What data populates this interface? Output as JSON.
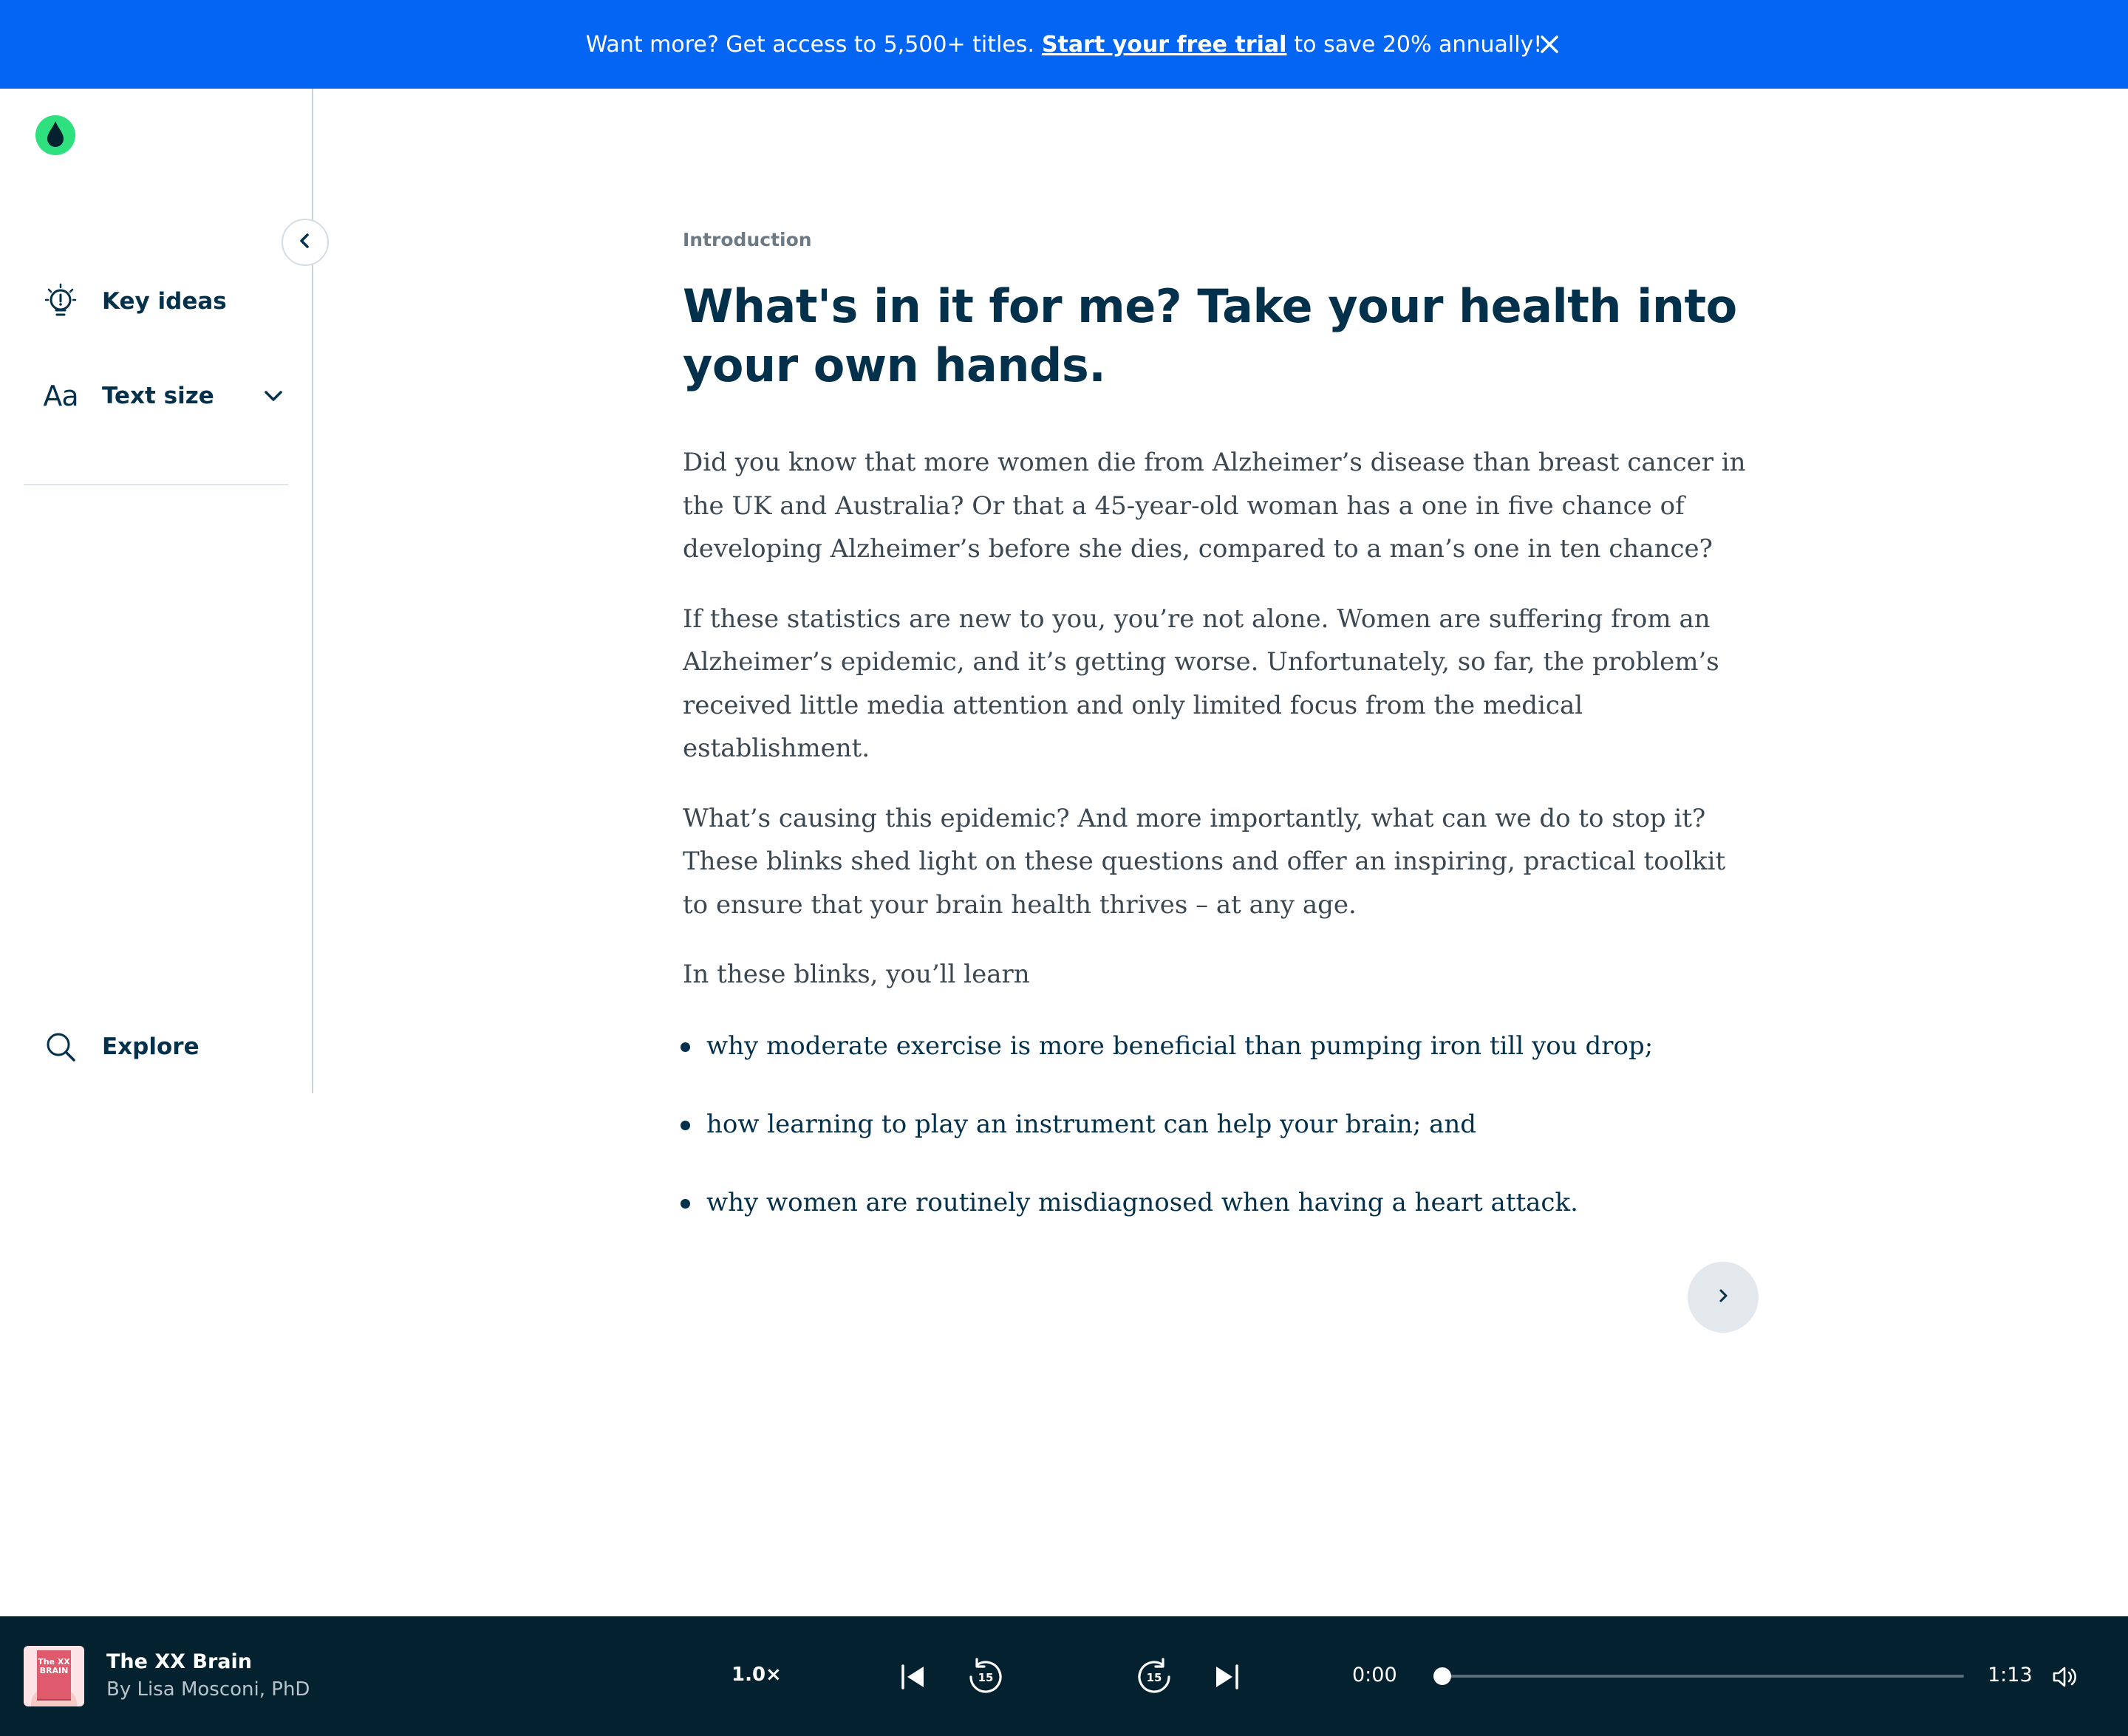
{
  "banner": {
    "text_before": "Want more? Get access to 5,500+ titles.",
    "link_text": "Start your free trial",
    "text_after": "to save 20% annually!",
    "close_icon": "close-icon",
    "background": "#0365f2"
  },
  "sidebar": {
    "logo_icon": "blinkist-logo-icon",
    "collapse_icon": "chevron-left-icon",
    "items": [
      {
        "label": "Key ideas",
        "icon": "lightbulb-icon"
      },
      {
        "label": "Text size",
        "icon": "text-size-icon",
        "icon_text": "Aa",
        "chevron": "chevron-down-icon"
      },
      {
        "label": "Explore",
        "icon": "search-icon"
      }
    ]
  },
  "content": {
    "eyebrow": "Introduction",
    "title": "What's in it for me? Take your health into your own hands.",
    "paragraphs": [
      "Did you know that more women die from Alzheimer’s disease than breast cancer in the UK and Australia? Or that a 45-year-old woman has a one in five chance of developing Alzheimer’s before she dies, compared to a man’s one in ten chance?",
      "If these statistics are new to you, you’re not alone. Women are suffering from an Alzheimer’s epidemic, and it’s getting worse. Unfortunately, so far, the problem’s received little media attention and only limited focus from the medical establishment.",
      "What’s causing this epidemic? And more importantly, what can we do to stop it? These blinks shed light on these questions and offer an inspiring, practical toolkit to ensure that your brain health thrives – at any age.",
      "In these blinks, you’ll learn"
    ],
    "bullets": [
      "why moderate exercise is more beneficial than pumping iron till you drop;",
      "how learning to play an instrument can help your brain; and",
      "why women are routinely misdiagnosed when having a heart attack."
    ],
    "next_icon": "chevron-right-icon"
  },
  "player": {
    "book_title": "The XX Brain",
    "author": "By Lisa Mosconi, PhD",
    "cover_text": "The XX BRAIN",
    "speed": "1.0×",
    "current_time": "0:00",
    "total_time": "1:13",
    "progress": 0.0,
    "icons": [
      "skip-previous-icon",
      "rewind-15-icon",
      "forward-15-icon",
      "skip-next-icon",
      "volume-icon"
    ],
    "rewind_label": "15",
    "forward_label": "15",
    "background": "#03212f"
  }
}
